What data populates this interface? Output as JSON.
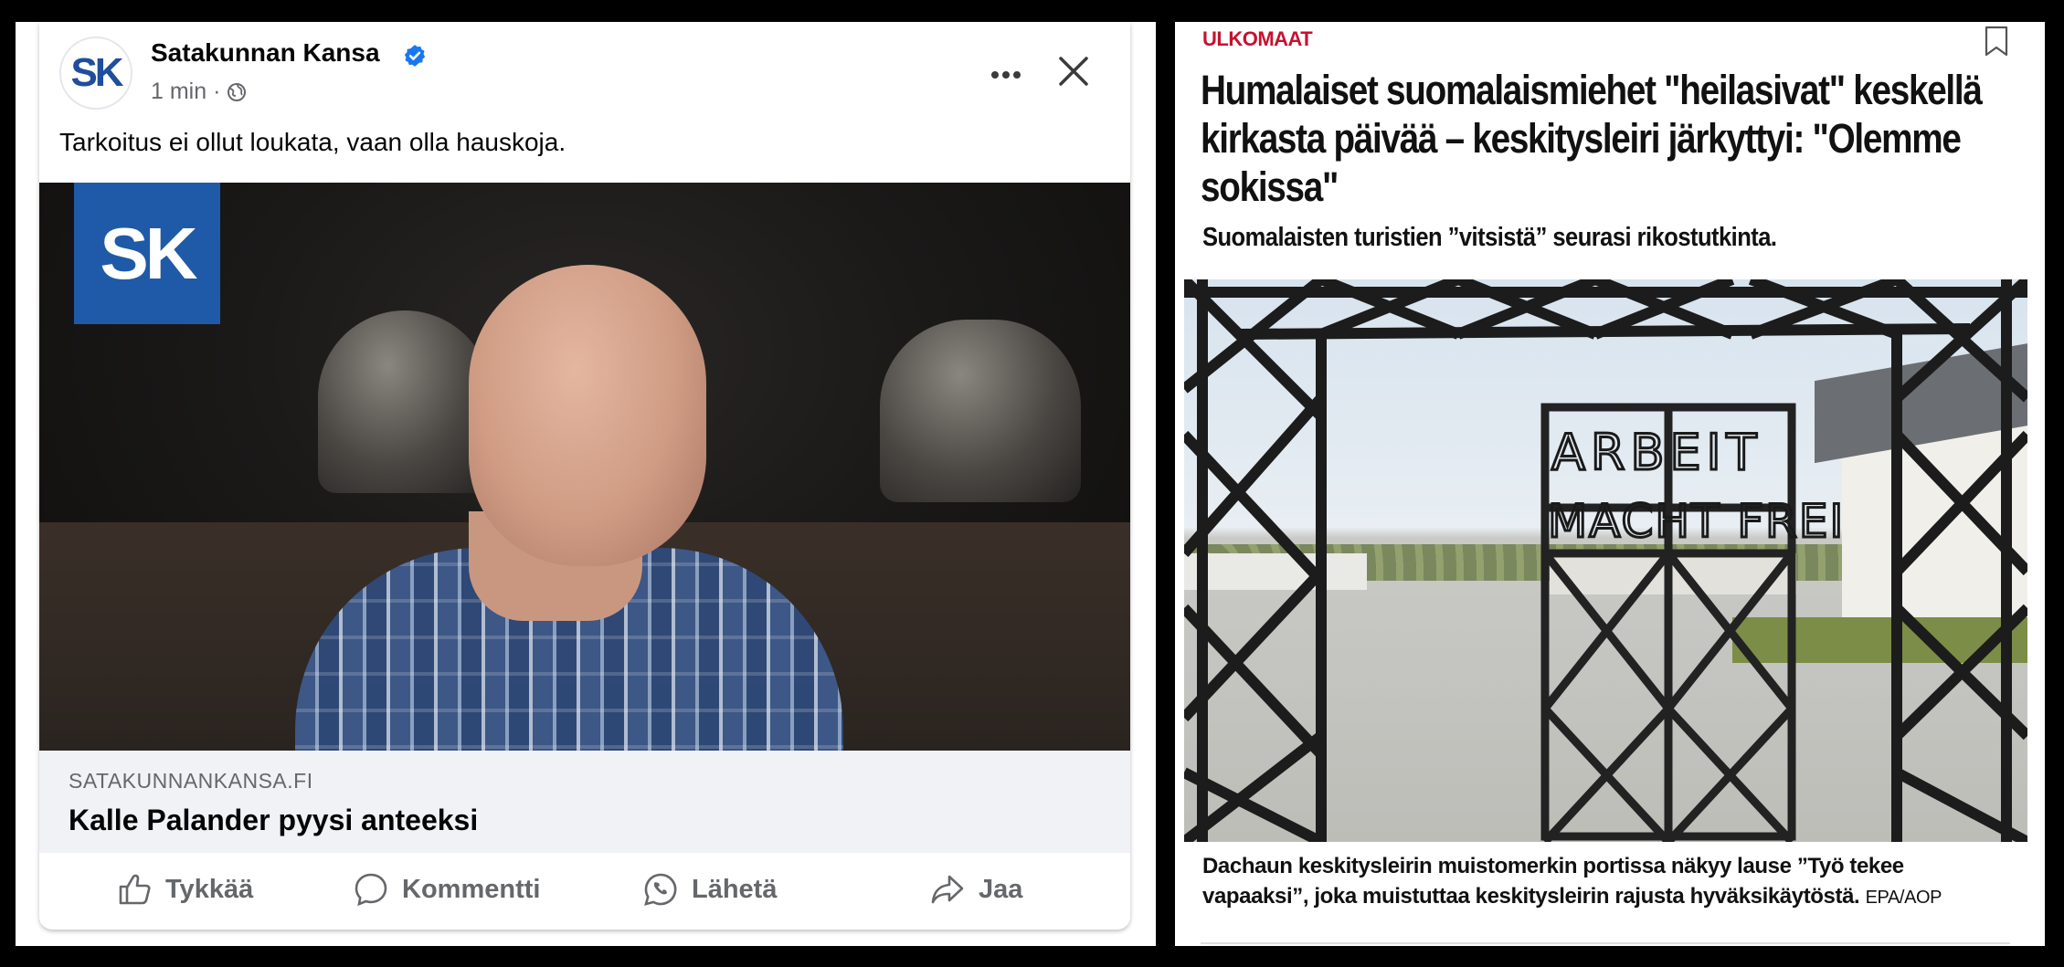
{
  "facebook_post": {
    "page_name": "Satakunnan Kansa",
    "avatar_text": "SK",
    "time": "1 min ·",
    "post_text": "Tarkoitus ei ollut loukata, vaan olla hauskoja.",
    "image_logo_text": "SK",
    "link_domain": "SATAKUNNANKANSA.FI",
    "link_title": "Kalle Palander pyysi anteeksi",
    "info_glyph": "i",
    "actions": {
      "like": "Tykkää",
      "comment": "Kommentti",
      "send": "Lähetä",
      "share": "Jaa"
    },
    "icons": [
      "verified-badge-icon",
      "globe-icon",
      "more-options-icon",
      "close-icon",
      "thumbs-up-icon",
      "comment-icon",
      "whatsapp-icon",
      "share-icon"
    ],
    "colors": {
      "verified": "#1877f2",
      "secondary_text": "#65676b",
      "link_bg": "#f0f2f5"
    }
  },
  "news_article": {
    "section": "ULKOMAAT",
    "title": "Humalaiset suomalaismiehet \"heilasivat\" keskellä kirkasta päivää – keskitysleiri järkyttyi: \"Olemme sokissa\"",
    "lead": "Suomalaisten turistien ”vitsistä” seurasi rikostutkinta.",
    "gate_sign_line1": "ARBEIT",
    "gate_sign_line2": "MACHT FREI",
    "caption": "Dachaun keskitysleirin muistomerkin portissa näkyy lause ”Työ tekee vapaaksi”, joka muistuttaa keskitysleirin rajusta hyväksikäytöstä.",
    "credit": "EPA/AOP",
    "icons": [
      "bookmark-icon"
    ],
    "colors": {
      "section": "#c8102e"
    }
  }
}
